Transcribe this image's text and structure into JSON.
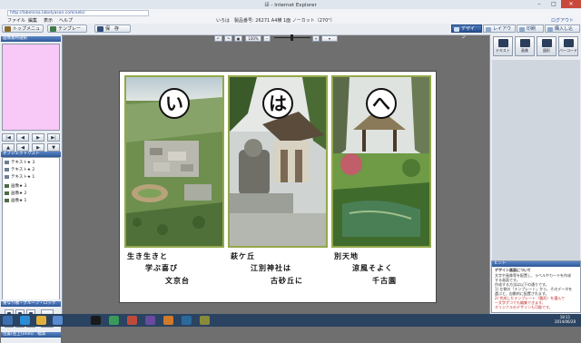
{
  "window": {
    "title": "ほ - Internet Explorer",
    "min": "–",
    "max": "□",
    "close": "✕"
  },
  "address": {
    "url": "http://labelxisa.labelyasan.com/xeki/"
  },
  "menubar": {
    "items": [
      "ファイル",
      "編集",
      "表示",
      "ヘルプ"
    ],
    "status": "いろは　製品番号: 26271 A4横 1面 ノーカット（270°）",
    "right_link": "ログアウト"
  },
  "toolbar": {
    "top_menu": "トップメニュー",
    "template": "テンプレート",
    "save": "保　存",
    "tabs": [
      "デザイン",
      "レイアウト",
      "印刷",
      "購入し込み"
    ],
    "active_tab": 0
  },
  "canvas_toolbar": {
    "zoom": "100%"
  },
  "left": {
    "preview_title": "画像素材選択",
    "object_list_title": "オブジェクトリスト",
    "objects": [
      {
        "label": "テキスト★ 3",
        "kind": "text"
      },
      {
        "label": "テキスト★ 2",
        "kind": "text"
      },
      {
        "label": "テキスト★ 1",
        "kind": "text"
      },
      {
        "label": "画像★ 3",
        "kind": "image"
      },
      {
        "label": "画像★ 2",
        "kind": "image"
      },
      {
        "label": "画像★ 1",
        "kind": "image"
      }
    ],
    "group_title": "重なり順・グループ・ロック",
    "position_title": "位置(左上)(mm)　幅高"
  },
  "cards": [
    {
      "kana": "い",
      "lines": [
        "生き生きと",
        "学ぶ喜び",
        "文京台"
      ]
    },
    {
      "kana": "は",
      "lines": [
        "萩ケ丘",
        "江別神社は",
        "古砂丘に"
      ]
    },
    {
      "kana": "へ",
      "lines": [
        "別天地",
        "涼風そよく",
        "千古園"
      ]
    }
  ],
  "right": {
    "buttons": [
      "テキスト",
      "画像",
      "図形",
      "バーコード"
    ],
    "hint_title": "ヒント",
    "hint_subtitle": "デザイン画面について",
    "hint_lines": [
      "文字や画像等を配置し、ラベルやカードを作成",
      "する画面です。",
      "作成する方法は以下の通りです。",
      "1) 左側の「テンプレート」から、そのデータを",
      "選ぶと、自動的に配置されます。",
      "2) 完成したテンプレート（雛形）を選んで",
      "一文字ずつでも編集できます。",
      "オリジナルのデザインも可能です。"
    ]
  },
  "taskbar": {
    "time": "18:11",
    "date": "2014/06/28"
  },
  "colors": {
    "accent": "#264f8e",
    "card_border": "#93a84a",
    "preview_bg": "#f8c8f6"
  }
}
